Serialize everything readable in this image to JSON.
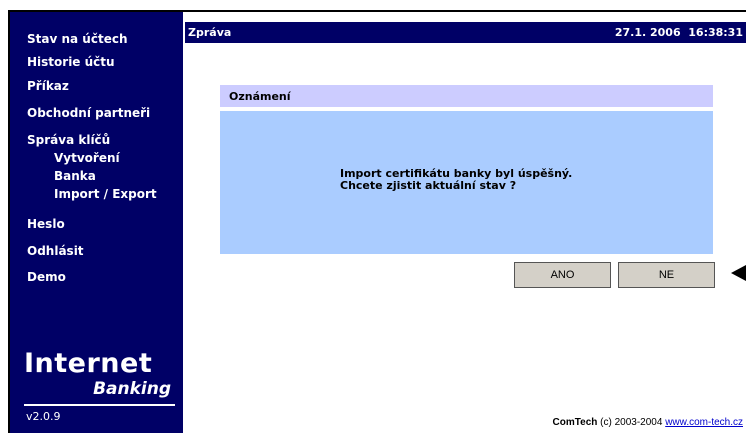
{
  "sidebar": {
    "items": [
      {
        "label": "Stav na účtech"
      },
      {
        "label": "Historie účtu"
      },
      {
        "label": "Příkaz"
      },
      {
        "label": "Obchodní partneři"
      },
      {
        "label": "Správa klíčů"
      },
      {
        "label": "Vytvoření"
      },
      {
        "label": "Banka"
      },
      {
        "label": "Import / Export"
      },
      {
        "label": "Heslo"
      },
      {
        "label": "Odhlásit"
      },
      {
        "label": "Demo"
      }
    ],
    "logo_line1": "Internet",
    "logo_line2": "Banking",
    "version": "v2.0.9"
  },
  "header": {
    "title": "Zpráva",
    "datetime": "27.1. 2006  16:38:31"
  },
  "dialog": {
    "title": "Oznámení",
    "message_line1": "Import certifikátu banky byl úspěšný.",
    "message_line2": "Chcete zjistit aktuální stav ?",
    "yes_label": "ANO",
    "no_label": "NE"
  },
  "footer": {
    "brand": "ComTech",
    "copyright": " (c) 2003-2004 ",
    "link": "www.com-tech.cz"
  },
  "colors": {
    "sidebar_bg": "#000066",
    "dialog_title_bg": "#ccccff",
    "dialog_body_bg": "#aaccff"
  }
}
